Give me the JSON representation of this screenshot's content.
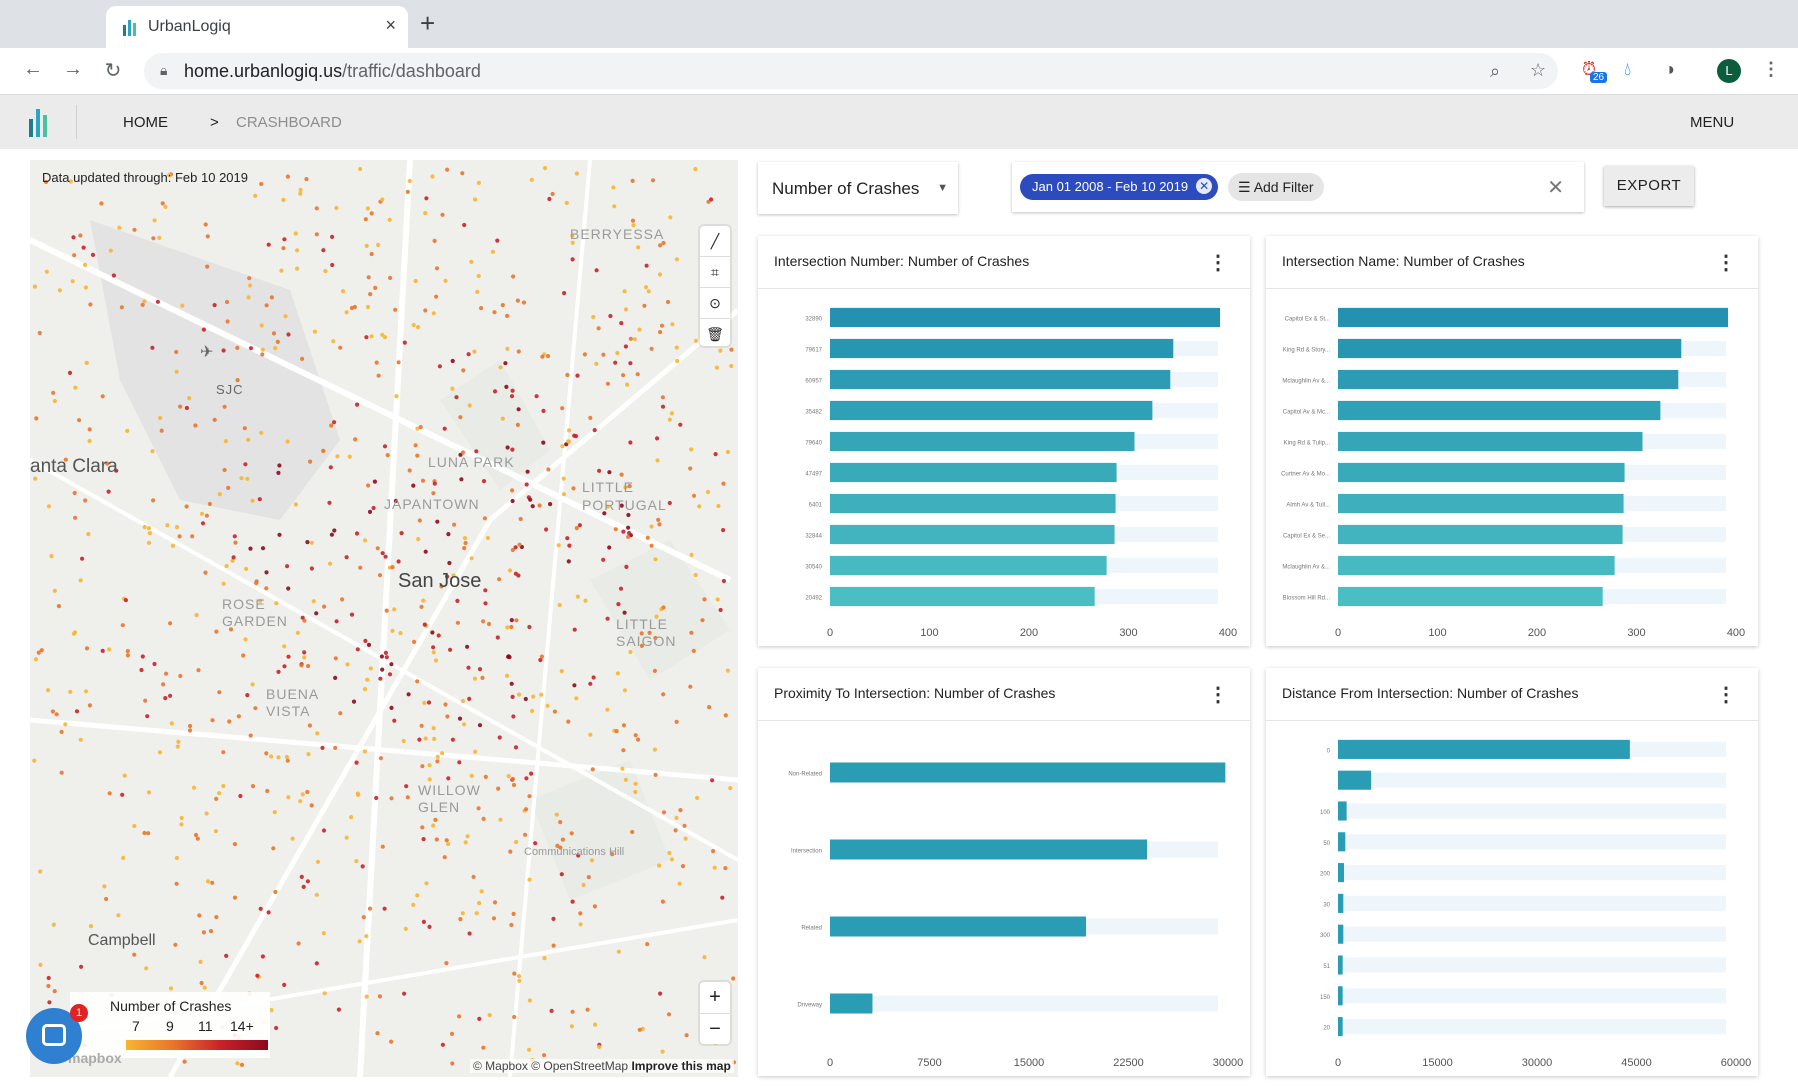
{
  "browser": {
    "tab_title": "UrbanLogiq",
    "tab_close": "×",
    "new_tab": "+",
    "url_host": "home.urbanlogiq.us",
    "url_path": "/traffic/dashboard",
    "extension_badge": "26",
    "profile_initial": "L"
  },
  "header": {
    "home": "HOME",
    "separator": ">",
    "breadcrumb": "CRASHBOARD",
    "menu": "MENU"
  },
  "map": {
    "updated": "Data updated through: Feb 10 2019",
    "labels": {
      "berryessa": "BERRYESSA",
      "sjc": "SJC",
      "santa_clara": "anta Clara",
      "luna_park": "LUNA PARK",
      "japantown": "JAPANTOWN",
      "little_portugal": "LITTLE PORTUGAL",
      "san_jose": "San Jose",
      "rose_garden": "ROSE GARDEN",
      "little_saigon": "LITTLE SAIGON",
      "buena_vista": "BUENA VISTA",
      "willow_glen": "WILLOW GLEN",
      "campbell": "Campbell",
      "communications_hill": "Communications Hill"
    },
    "legend": {
      "title": "Number of Crashes",
      "ticks": [
        "7",
        "9",
        "11",
        "14+"
      ]
    },
    "attribution": "© Mapbox © OpenStreetMap",
    "improve": "Improve this map",
    "mapbox_logo": "mapbox",
    "chat_badge": "1",
    "colors": [
      "#f7b531",
      "#e8752c",
      "#c8222a",
      "#8b0a1d"
    ]
  },
  "filters": {
    "metric": "Number of Crashes",
    "date_range": "Jan 01 2008 - Feb 10 2019",
    "add_filter": "Add Filter",
    "export": "EXPORT"
  },
  "accent": "#2a9cb4",
  "chart_data": [
    {
      "type": "bar",
      "title": "Intersection Number: Number of Crashes",
      "categories": [
        "32890",
        "79617",
        "60957",
        "35482",
        "79640",
        "47497",
        "6401",
        "32844",
        "30540",
        "20492"
      ],
      "values": [
        392,
        345,
        342,
        324,
        306,
        288,
        287,
        286,
        278,
        266
      ],
      "xlim": [
        0,
        400
      ],
      "xticks": [
        0,
        100,
        200,
        300,
        400
      ]
    },
    {
      "type": "bar",
      "title": "Intersection Name: Number of Crashes",
      "categories": [
        "Capitol Ex & St...",
        "King Rd & Story...",
        "Mclaughlin Av &...",
        "Capitol Av & Mc...",
        "King Rd & Tulip...",
        "Curtner Av & Mo...",
        "Almh Av & Tull...",
        "Capitol Ex & Se...",
        "Mclaughlin Av &...",
        "Blossom Hill Rd..."
      ],
      "values": [
        392,
        345,
        342,
        324,
        306,
        288,
        287,
        286,
        278,
        266
      ],
      "xlim": [
        0,
        400
      ],
      "xticks": [
        0,
        100,
        200,
        300,
        400
      ]
    },
    {
      "type": "bar",
      "title": "Proximity To Intersection: Number of Crashes",
      "categories": [
        "Non-Related",
        "Intersection",
        "Related",
        "Driveway"
      ],
      "values": [
        29800,
        23900,
        19300,
        3200
      ],
      "xlim": [
        0,
        30000
      ],
      "xticks": [
        0,
        7500,
        15000,
        22500,
        30000
      ]
    },
    {
      "type": "bar",
      "title": "Distance From Intersection: Number of Crashes",
      "categories": [
        "0",
        "",
        "100",
        "50",
        "200",
        "30",
        "300",
        "51",
        "150",
        "20"
      ],
      "values": [
        44000,
        5000,
        1300,
        1100,
        900,
        800,
        800,
        700,
        700,
        700
      ],
      "xlim": [
        0,
        60000
      ],
      "xticks": [
        0,
        15000,
        30000,
        45000,
        60000
      ]
    }
  ]
}
